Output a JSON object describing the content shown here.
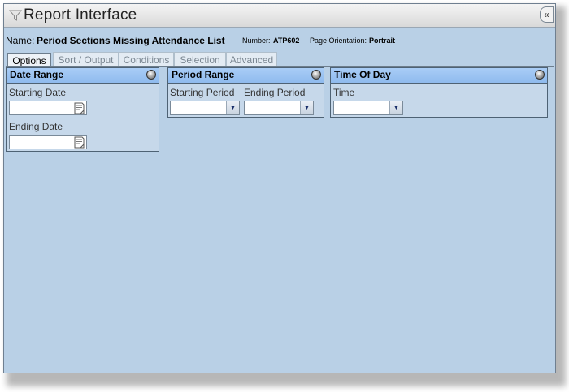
{
  "window": {
    "title": "Report Interface",
    "collapse_label": "«"
  },
  "info": {
    "name_label": "Name:",
    "name_value": "Period Sections Missing Attendance List",
    "number_label": "Number:",
    "number_value": "ATP602",
    "orientation_label": "Page Orientation:",
    "orientation_value": "Portrait"
  },
  "tabs": [
    "Options",
    "Sort / Output",
    "Conditions",
    "Selection",
    "Advanced"
  ],
  "panels": {
    "date_range": {
      "title": "Date Range",
      "starting_label": "Starting Date",
      "starting_value": "",
      "ending_label": "Ending Date",
      "ending_value": ""
    },
    "period_range": {
      "title": "Period Range",
      "starting_label": "Starting Period",
      "starting_value": "",
      "ending_label": "Ending Period",
      "ending_value": ""
    },
    "time_of_day": {
      "title": "Time Of Day",
      "time_label": "Time",
      "time_value": ""
    }
  },
  "icons": {
    "title": "funnel-icon",
    "calendar": "calendar-icon",
    "dropdown": "chevron-down-icon",
    "panel_toggle": "toggle-circle-icon"
  }
}
